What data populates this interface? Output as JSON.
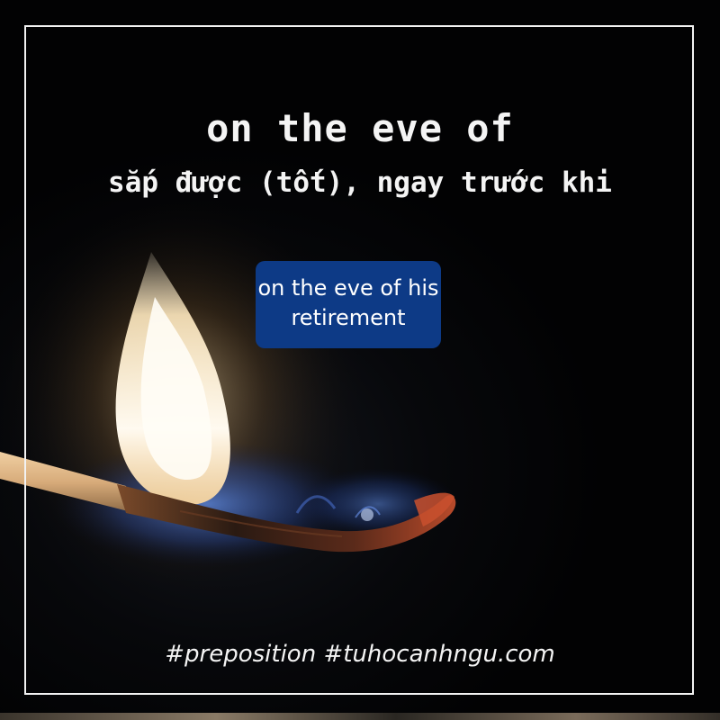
{
  "card": {
    "phrase": "on the eve of",
    "meaning": "sắp được (tốt), ngay trước khi",
    "example_line1": "on the eve of his",
    "example_line2": "retirement",
    "hashtags": "#preposition #tuhocanhngu.com"
  },
  "colors": {
    "background": "#050608",
    "frame": "#f2f2f2",
    "text": "#f4f4f4",
    "example_box": "#0d3a86",
    "flame_core": "#fff6e0",
    "flame_blue": "#3d6fd6",
    "match_stick": "#d9b48a",
    "ember": "#b53a1e"
  }
}
